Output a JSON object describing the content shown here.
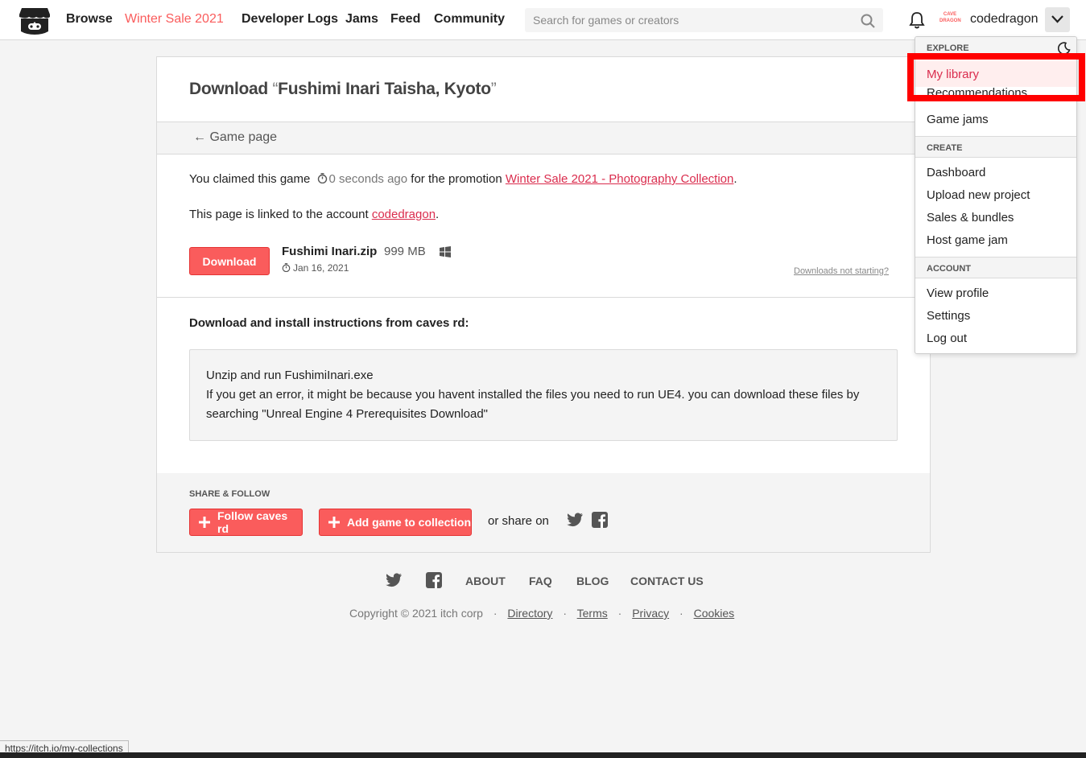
{
  "header": {
    "nav": [
      "Browse",
      "Winter Sale 2021",
      "Developer Logs",
      "Jams",
      "Feed",
      "Community"
    ],
    "search_placeholder": "Search for games or creators",
    "avatar_text": "CAVE DRAGON",
    "username": "codedragon"
  },
  "card": {
    "title_prefix": "Download ",
    "open_quote": "“",
    "title_name": "Fushimi Inari Taisha, Kyoto",
    "close_quote": "”",
    "back_link": "← Game page",
    "claimed_prefix": "You claimed this game",
    "claimed_time": "0 seconds ago",
    "claimed_mid": "for the promotion",
    "promotion_link": "Winter Sale 2021 - Photography Collection",
    "claimed_suffix": ".",
    "linked_prefix": "This page is linked to the account",
    "linked_account": "codedragon",
    "linked_suffix": ".",
    "download_button": "Download",
    "file_name": "Fushimi Inari.zip",
    "file_size": "999 MB",
    "file_date": "Jan 16, 2021",
    "not_starting": "Downloads not starting?",
    "instructions_title": "Download and install instructions from caves rd:",
    "instructions_line1": "Unzip and run FushimiInari.exe",
    "instructions_line2": "If you get an error, it might be because you havent installed the files you need to run UE4. you can download these files by searching \"Unreal Engine 4 Prerequisites Download\"",
    "share_label": "SHARE & FOLLOW",
    "follow_button": "Follow caves rd",
    "collection_button": "Add game to collection",
    "share_on": "or share on"
  },
  "footer": {
    "links": [
      "ABOUT",
      "FAQ",
      "BLOG",
      "CONTACT US"
    ],
    "copyright": "Copyright © 2021 itch corp",
    "legal": [
      "Directory",
      "Terms",
      "Privacy",
      "Cookies"
    ],
    "separator": "·"
  },
  "menu": {
    "explore_head": "EXPLORE",
    "my_library": "My library",
    "recommendations": "Recommendations",
    "game_jams": "Game jams",
    "create_head": "CREATE",
    "create_items": [
      "Dashboard",
      "Upload new project",
      "Sales & bundles",
      "Host game jam"
    ],
    "account_head": "ACCOUNT",
    "account_items": [
      "View profile",
      "Settings",
      "Log out"
    ]
  },
  "status_url": "https://itch.io/my-collections",
  "colors": {
    "accent": "#fa5c5c",
    "link": "#da2c4d",
    "highlight": "#ff0000"
  }
}
